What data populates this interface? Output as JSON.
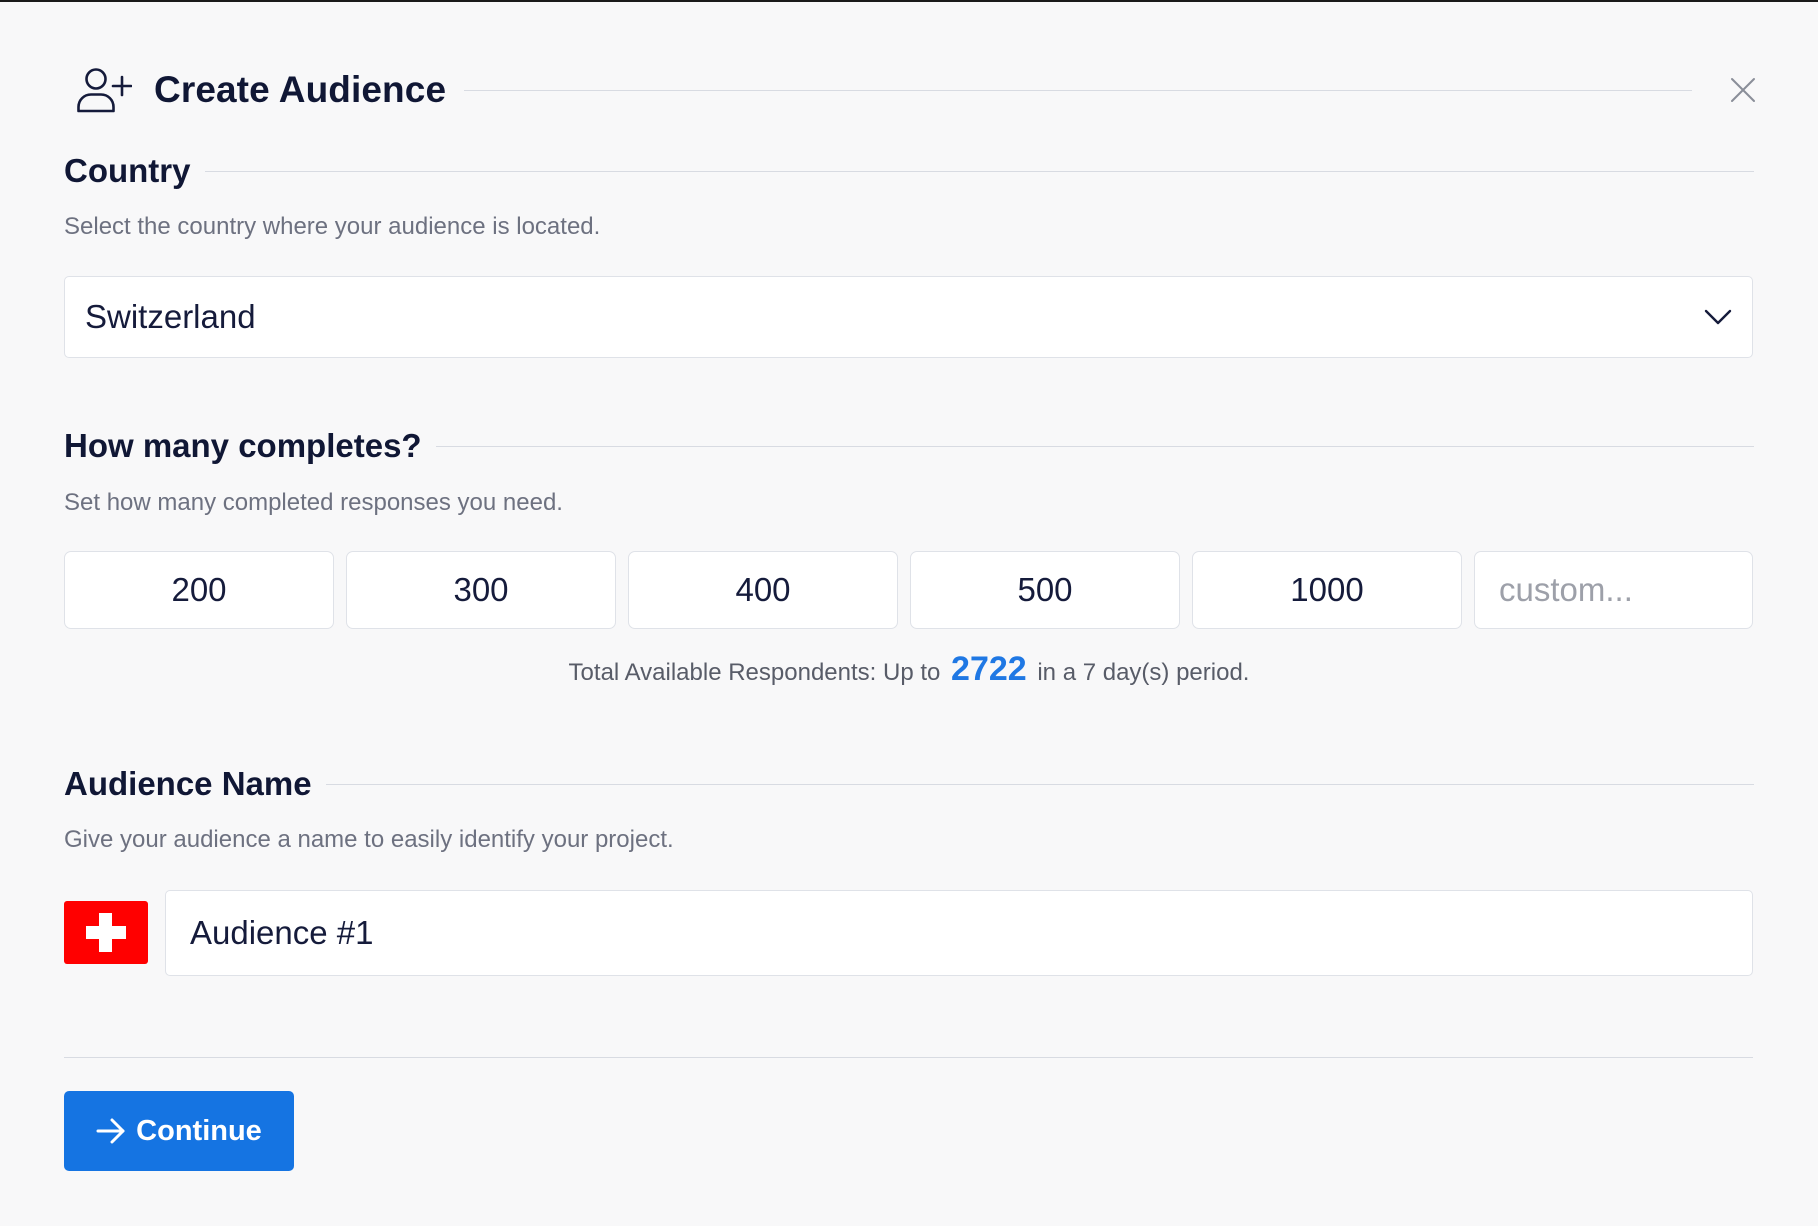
{
  "header": {
    "title": "Create Audience",
    "icon": "add-user-icon",
    "close_icon": "close-icon"
  },
  "country_section": {
    "title": "Country",
    "description": "Select the country where your audience is located.",
    "selected_value": "Switzerland",
    "dropdown_icon": "chevron-down-icon"
  },
  "completes_section": {
    "title": "How many completes?",
    "description": "Set how many completed responses you need.",
    "options": [
      "200",
      "300",
      "400",
      "500",
      "1000"
    ],
    "custom_placeholder": "custom..."
  },
  "availability": {
    "prefix": "Total Available Respondents: Up to",
    "count": "2722",
    "suffix": "in a 7 day(s) period."
  },
  "name_section": {
    "title": "Audience Name",
    "description": "Give your audience a name to easily identify your project.",
    "value": "Audience #1",
    "flag_icon": "switzerland-flag-icon"
  },
  "footer": {
    "continue_label": "Continue",
    "continue_icon": "arrow-right-icon"
  },
  "colors": {
    "primary": "#1574e2",
    "count_highlight": "#1f78e4",
    "text_dark": "#101735",
    "text_muted": "#6d7180",
    "flag_red": "#ff0000"
  }
}
